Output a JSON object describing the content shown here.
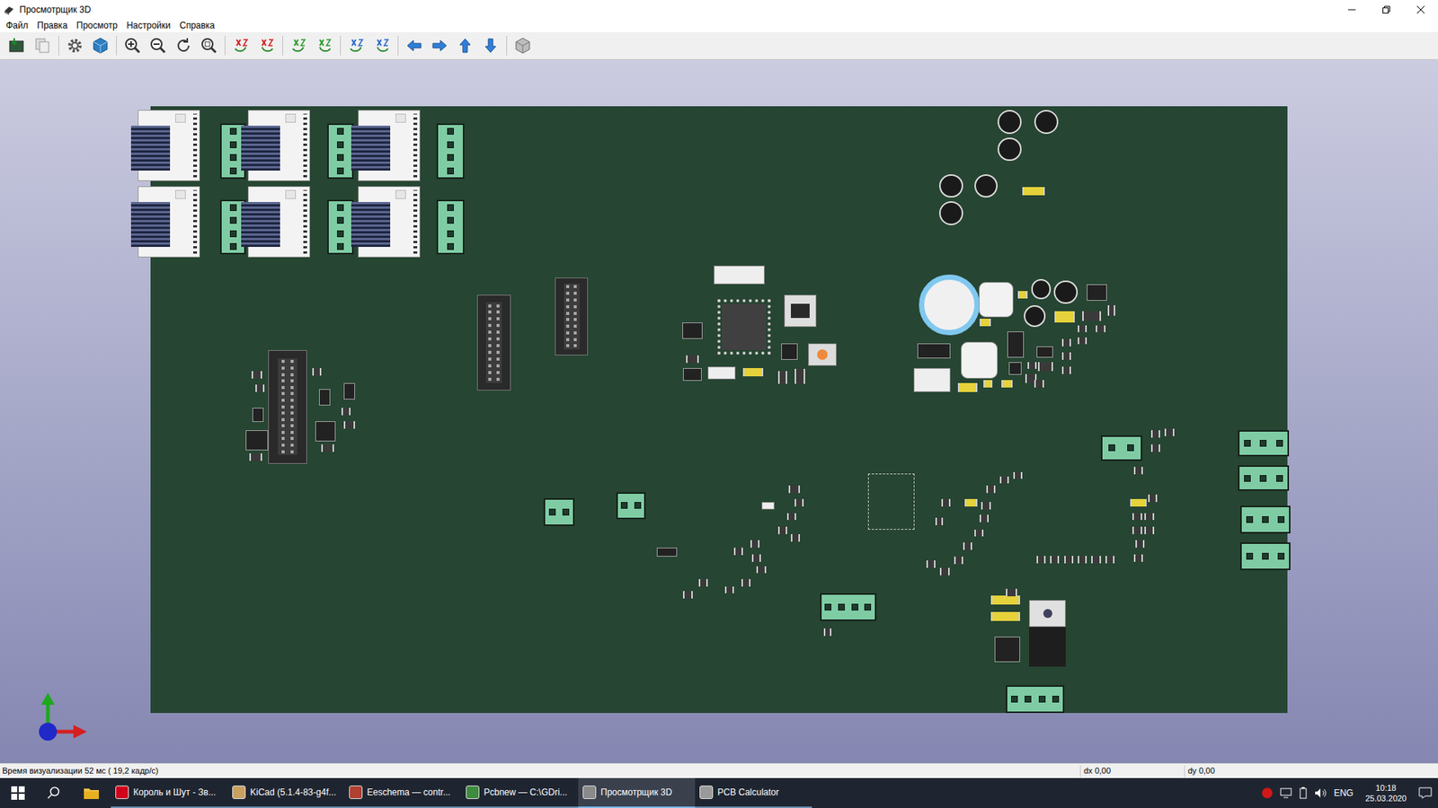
{
  "window": {
    "title": "Просмотрщик 3D"
  },
  "menu": [
    "Файл",
    "Правка",
    "Просмотр",
    "Настройки",
    "Справка"
  ],
  "status_bar": {
    "render_time": "Время визуализации 52 мс ( 19,2 кадр/с)",
    "dx": "dx 0,00",
    "dy": "dy 0,00"
  },
  "taskbar": {
    "apps": [
      {
        "label": "Король и Шут - Зв...",
        "selected": false,
        "color": "#d0021b"
      },
      {
        "label": "KiCad (5.1.4-83-g4f...",
        "selected": false,
        "color": "#c8a060"
      },
      {
        "label": "Eeschema — contr...",
        "selected": false,
        "color": "#b04030"
      },
      {
        "label": "Pcbnew — C:\\GDri...",
        "selected": false,
        "color": "#3e8a3e"
      },
      {
        "label": "Просмотрщик 3D",
        "selected": true,
        "color": "#8a8a8a"
      },
      {
        "label": "PCB Calculator",
        "selected": false,
        "color": "#9a9a9a"
      }
    ],
    "tray": {
      "language": "ENG",
      "time": "10:18",
      "date": "25.03.2020"
    }
  }
}
